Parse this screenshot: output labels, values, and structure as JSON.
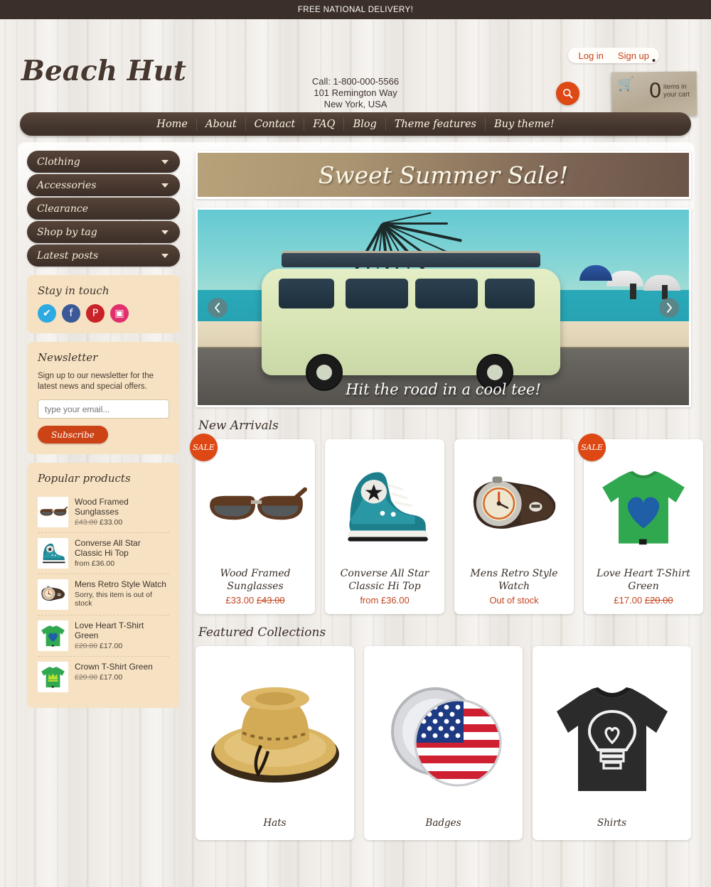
{
  "announcement": "FREE NATIONAL DELIVERY!",
  "header": {
    "logo": "Beach Hut",
    "contact_phone": "Call: 1-800-000-5566",
    "contact_street": "101 Remington Way",
    "contact_city": "New York, USA",
    "login_label": "Log in",
    "signup_label": "Sign up",
    "cart_count": "0",
    "cart_label_line1": "items in",
    "cart_label_line2": "your cart",
    "search_icon": "search-icon",
    "cart_icon": "shopping-cart-icon"
  },
  "nav": {
    "items": [
      {
        "label": "Home"
      },
      {
        "label": "About"
      },
      {
        "label": "Contact"
      },
      {
        "label": "FAQ"
      },
      {
        "label": "Blog"
      },
      {
        "label": "Theme features"
      },
      {
        "label": "Buy theme!"
      }
    ]
  },
  "sidebar": {
    "categories": [
      {
        "label": "Clothing",
        "has_caret": true
      },
      {
        "label": "Accessories",
        "has_caret": true
      },
      {
        "label": "Clearance",
        "has_caret": false
      },
      {
        "label": "Shop by tag",
        "has_caret": true
      },
      {
        "label": "Latest posts",
        "has_caret": true
      }
    ],
    "social": {
      "title": "Stay in touch",
      "items": [
        {
          "name": "twitter-icon",
          "glyph": "✔",
          "color": "#2daae1"
        },
        {
          "name": "facebook-icon",
          "glyph": "f",
          "color": "#3b5998"
        },
        {
          "name": "pinterest-icon",
          "glyph": "P",
          "color": "#c92228"
        },
        {
          "name": "instagram-icon",
          "glyph": "▣",
          "color": "#e1306c"
        }
      ]
    },
    "newsletter": {
      "title": "Newsletter",
      "description": "Sign up to our newsletter for the latest news and special offers.",
      "placeholder": "type your email...",
      "button_label": "Subscribe"
    },
    "popular": {
      "title": "Popular products",
      "items": [
        {
          "title": "Wood Framed Sunglasses",
          "old_price": "£43.00",
          "price": "£33.00",
          "status": ""
        },
        {
          "title": "Converse All Star Classic Hi Top",
          "old_price": "",
          "price": "from £36.00",
          "status": ""
        },
        {
          "title": "Mens Retro Style Watch",
          "old_price": "",
          "price": "",
          "status": "Sorry, this item is out of stock"
        },
        {
          "title": "Love Heart T-Shirt Green",
          "old_price": "£20.00",
          "price": "£17.00",
          "status": ""
        },
        {
          "title": "Crown T-Shirt Green",
          "old_price": "£20.00",
          "price": "£17.00",
          "status": ""
        }
      ]
    }
  },
  "main": {
    "promo_banner": "Sweet Summer Sale!",
    "slideshow": {
      "caption": "Hit the road in a cool tee!",
      "prev_icon": "chevron-left-icon",
      "next_icon": "chevron-right-icon"
    },
    "new_arrivals": {
      "title": "New Arrivals",
      "sale_badge": "SALE",
      "products": [
        {
          "name": "Wood Framed Sunglasses",
          "price": "£33.00",
          "old_price": "£43.00",
          "on_sale": true,
          "status": ""
        },
        {
          "name": "Converse All Star Classic Hi Top",
          "price": "from £36.00",
          "old_price": "",
          "on_sale": false,
          "status": ""
        },
        {
          "name": "Mens Retro Style Watch",
          "price": "",
          "old_price": "",
          "on_sale": false,
          "status": "Out of stock"
        },
        {
          "name": "Love Heart T-Shirt Green",
          "price": "£17.00",
          "old_price": "£20.00",
          "on_sale": true,
          "status": ""
        }
      ]
    },
    "featured_collections": {
      "title": "Featured Collections",
      "collections": [
        {
          "name": "Hats"
        },
        {
          "name": "Badges"
        },
        {
          "name": "Shirts"
        }
      ]
    }
  },
  "colors": {
    "accent": "#dd4814",
    "dark_brown": "#453730",
    "cream_panel": "#f6e2c3",
    "price_red": "#c0451f"
  }
}
